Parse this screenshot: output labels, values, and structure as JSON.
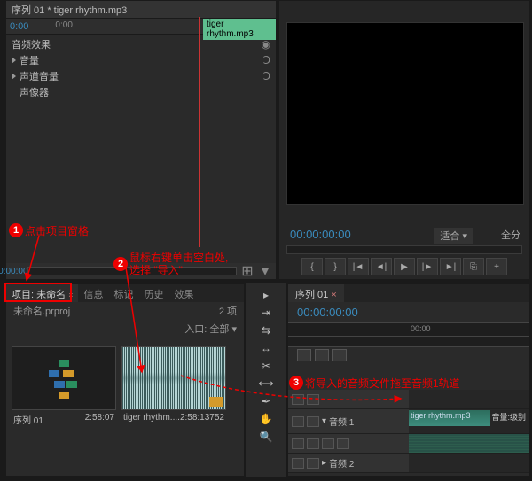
{
  "fx": {
    "tab_title": "序列 01 * tiger rhythm.mp3",
    "timecode": "0:00",
    "ruler_tick": "0:00",
    "section": "音频效果",
    "items": [
      "音量",
      "声道音量",
      "声像器"
    ],
    "clip_label": "tiger rhythm.mp3"
  },
  "monitor": {
    "timecode": "00:00:00:00",
    "fit": "适合",
    "full": "全分"
  },
  "project": {
    "tabs": [
      "项目: 未命名",
      "信息",
      "标记",
      "历史",
      "效果"
    ],
    "filename": "未命名.prproj",
    "item_count": "2 项",
    "entry_label": "入口:",
    "entry_value": "全部",
    "seq_name": "序列 01",
    "seq_dur": "2:58:07",
    "clip_name": "tiger rhythm....",
    "clip_dur": "2:58:13752"
  },
  "timeline": {
    "tab": "序列 01",
    "timecode": "00:00:00:00",
    "ruler_tick": "00:00",
    "audio_track1": "音频 1",
    "audio_track2": "音频 2",
    "clip_name": "tiger rhythm.mp3",
    "level": "音量:级别"
  },
  "annotations": {
    "a1": "点击项目窗格",
    "a2a": "鼠标右键单击空白处,",
    "a2b": "选择 \"导入\"",
    "a3": "将导入的音频文件拖至音频1轨道"
  }
}
